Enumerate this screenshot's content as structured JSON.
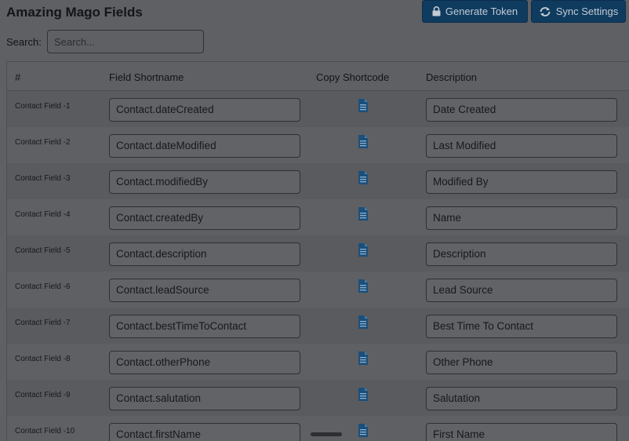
{
  "header": {
    "title": "Amazing Mago Fields",
    "generate_token_label": "Generate Token",
    "sync_settings_label": "Sync Settings"
  },
  "search": {
    "label": "Search:",
    "placeholder": "Search..."
  },
  "table": {
    "columns": [
      "#",
      "Field Shortname",
      "Copy Shortcode",
      "Description"
    ],
    "rows": [
      {
        "index": "Contact Field -1",
        "shortname": "Contact.dateCreated",
        "description": "Date Created"
      },
      {
        "index": "Contact Field -2",
        "shortname": "Contact.dateModified",
        "description": "Last Modified"
      },
      {
        "index": "Contact Field -3",
        "shortname": "Contact.modifiedBy",
        "description": "Modified By"
      },
      {
        "index": "Contact Field -4",
        "shortname": "Contact.createdBy",
        "description": "Name"
      },
      {
        "index": "Contact Field -5",
        "shortname": "Contact.description",
        "description": "Description"
      },
      {
        "index": "Contact Field -6",
        "shortname": "Contact.leadSource",
        "description": "Lead Source"
      },
      {
        "index": "Contact Field -7",
        "shortname": "Contact.bestTimeToContact",
        "description": "Best Time To Contact"
      },
      {
        "index": "Contact Field -8",
        "shortname": "Contact.otherPhone",
        "description": "Other Phone"
      },
      {
        "index": "Contact Field -9",
        "shortname": "Contact.salutation",
        "description": "Salutation"
      },
      {
        "index": "Contact Field -10",
        "shortname": "Contact.firstName",
        "description": "First Name"
      }
    ]
  },
  "icons": {
    "generate_token": "lock-icon",
    "sync_settings": "sync-icon",
    "copy_shortcode": "document-icon"
  },
  "colors": {
    "button_bg": "#0f3b5f",
    "copy_icon": "#1b4f7a"
  }
}
